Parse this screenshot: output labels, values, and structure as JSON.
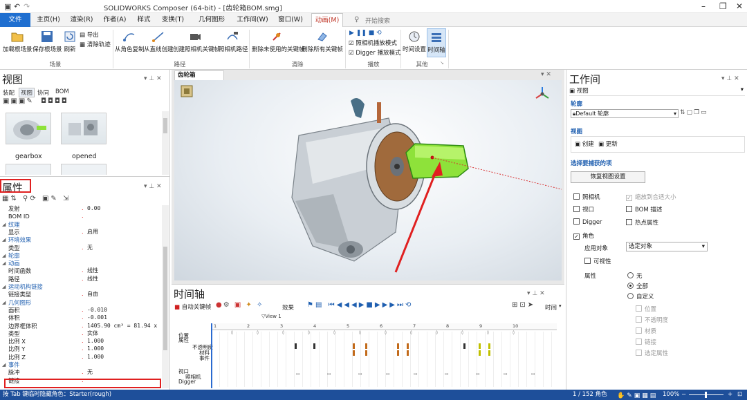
{
  "window": {
    "title": "SOLIDWORKS Composer (64-bit) - [齿轮箱BOM.smg]"
  },
  "ribbon_tabs": [
    "文件",
    "主页(H)",
    "渲染(R)",
    "作者(A)",
    "样式",
    "变换(T)",
    "几何图形(G)",
    "工作间(W)",
    "窗口(W)",
    "动画(M)"
  ],
  "search_label": "开始搜索",
  "ribbon": {
    "scene": {
      "items": [
        "加载根场景",
        "保存根场景",
        "刷新"
      ],
      "small": [
        "导出",
        "清除轨迹"
      ],
      "label": "场景"
    },
    "path": {
      "items": [
        "从角色复制",
        "从直线创建",
        "创建照相机关键帧",
        "照相机路径"
      ],
      "label": "路径"
    },
    "clear": {
      "items": [
        "删除未使用的关键帧",
        "删除所有关键帧"
      ],
      "label": "清除"
    },
    "play": {
      "checks": [
        "照相机播放模式",
        "Digger 播放模式"
      ],
      "label": "播放"
    },
    "other": {
      "items": [
        "时间设置",
        "时间轴"
      ],
      "label": "其他"
    }
  },
  "left_panel": {
    "view_title": "视图",
    "tabs": [
      "装配",
      "视图",
      "协同",
      "BOM"
    ],
    "thumbs": [
      "gearbox",
      "opened"
    ],
    "props_title": "属性",
    "rows": [
      {
        "k": "发射",
        "v": "0.00"
      },
      {
        "k": "BOM ID",
        "v": ""
      },
      {
        "k": "纹理",
        "v": "",
        "sec": true
      },
      {
        "k": "显示",
        "v": "启用"
      },
      {
        "k": "环境效果",
        "v": "",
        "sec": true
      },
      {
        "k": "类型",
        "v": "无"
      },
      {
        "k": "轮廓",
        "v": "",
        "sec": true
      },
      {
        "k": "动画",
        "v": "",
        "sec": true
      },
      {
        "k": "时间函数",
        "v": "线性"
      },
      {
        "k": "路径",
        "v": "线性"
      },
      {
        "k": "运动机构链接",
        "v": "",
        "sec": true
      },
      {
        "k": "链接类型",
        "v": "自由"
      },
      {
        "k": "几何图形",
        "v": "",
        "sec": true
      },
      {
        "k": "面积",
        "v": "-0.010"
      },
      {
        "k": "体积",
        "v": "-0.001"
      },
      {
        "k": "边界框体积",
        "v": "1405.90 cm³ = 81.94 x 20"
      },
      {
        "k": "类型",
        "v": "实体"
      },
      {
        "k": "比例 X",
        "v": "1.000"
      },
      {
        "k": "比例 Y",
        "v": "1.000"
      },
      {
        "k": "比例 Z",
        "v": "1.000"
      },
      {
        "k": "事件",
        "v": "",
        "sec": true
      },
      {
        "k": "脉冲",
        "v": "无"
      },
      {
        "k": "链接",
        "v": ""
      }
    ]
  },
  "doc_tab": "齿轮箱BOM.smg",
  "timeline": {
    "title": "时间轴",
    "auto_key": "自动关键帧",
    "effects": "效果",
    "time": "时间",
    "view_marker": "View 1",
    "ticks": [
      "1",
      "2",
      "3",
      "4",
      "5",
      "6",
      "7",
      "8",
      "9",
      "10"
    ],
    "tracks": [
      "位置",
      "属性",
      "不透明度",
      "材料",
      "事件",
      "视口",
      "照相机",
      "Digger"
    ]
  },
  "right_panel": {
    "title": "工作间",
    "view_item": "视图",
    "outline_label": "轮廓",
    "outline_value": "Default 轮廓",
    "view_label": "视图",
    "create": "创建",
    "update": "更新",
    "capture_label": "选择要捕获的项",
    "restore_btn": "恢复视图设置",
    "checks_left": [
      {
        "label": "照相机",
        "checked": false
      },
      {
        "label": "视口",
        "checked": false
      },
      {
        "label": "Digger",
        "checked": false
      },
      {
        "label": "角色",
        "checked": true
      }
    ],
    "checks_right": [
      {
        "label": "缩放到合适大小",
        "checked": true,
        "disabled": true
      },
      {
        "label": "BOM 描述",
        "checked": false
      },
      {
        "label": "热点属性",
        "checked": false
      }
    ],
    "apply_label": "应用对象",
    "apply_value": "选定对象",
    "visibility": "可视性",
    "attr_label": "属性",
    "radios": [
      {
        "label": "无",
        "on": false
      },
      {
        "label": "全部",
        "on": true
      },
      {
        "label": "自定义",
        "on": false
      }
    ],
    "sub_checks": [
      "位置",
      "不透明度",
      "材质",
      "链接",
      "选定属性"
    ]
  },
  "status": {
    "left": "按 Tab 键临时隐藏角色：Starter(rough)",
    "count": "1 / 152 角色",
    "zoom": "100%"
  },
  "colors": {
    "accent": "#1f6fd0",
    "status": "#1e4f9a",
    "highlight": "#e02020",
    "selected_green": "#8ee23a"
  }
}
